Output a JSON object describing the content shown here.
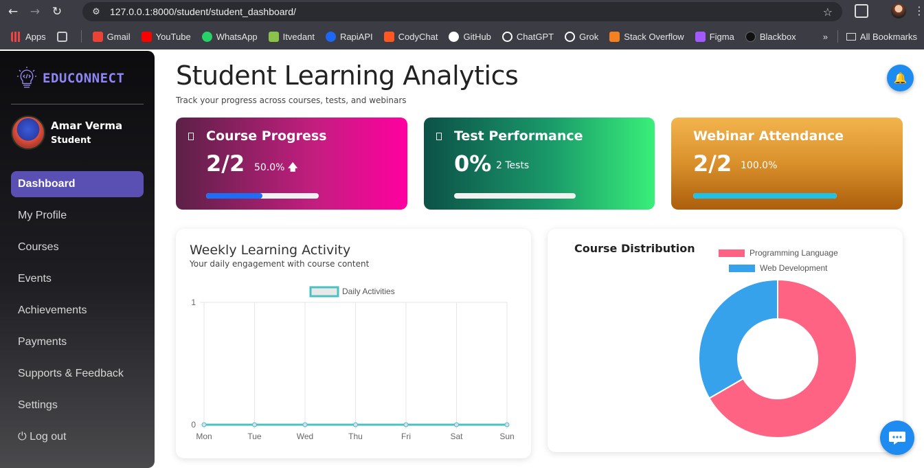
{
  "browser": {
    "url": "127.0.0.1:8000/student/student_dashboard/",
    "bookmarks": [
      {
        "label": "Apps",
        "color": "#e44"
      },
      {
        "label": "",
        "color": "transparent"
      },
      {
        "label": "Gmail",
        "color": "#ea4335"
      },
      {
        "label": "YouTube",
        "color": "#ff0000"
      },
      {
        "label": "WhatsApp",
        "color": "#25d366"
      },
      {
        "label": "Itvedant",
        "color": "#8bc34a"
      },
      {
        "label": "RapiAPI",
        "color": "#1e66f5"
      },
      {
        "label": "CodyChat",
        "color": "#ff5722"
      },
      {
        "label": "GitHub",
        "color": "#ffffff"
      },
      {
        "label": "ChatGPT",
        "color": "#ffffff"
      },
      {
        "label": "Grok",
        "color": "#ffffff"
      },
      {
        "label": "Stack Overflow",
        "color": "#f48024"
      },
      {
        "label": "Figma",
        "color": "#a259ff"
      },
      {
        "label": "Blackbox",
        "color": "#222222"
      }
    ],
    "all_bookmarks": "All Bookmarks"
  },
  "sidebar": {
    "brand": "EDUCONNECT",
    "user_name": "Amar Verma",
    "user_role": "Student",
    "items": [
      {
        "label": "Dashboard",
        "active": true
      },
      {
        "label": "My Profile"
      },
      {
        "label": "Courses"
      },
      {
        "label": "Events"
      },
      {
        "label": "Achievements"
      },
      {
        "label": "Payments"
      },
      {
        "label": "Supports & Feedback"
      },
      {
        "label": "Settings"
      },
      {
        "label": "⏻ Log out"
      }
    ]
  },
  "header": {
    "title": "Student Learning Analytics",
    "subtitle": "Track your progress across courses, tests, and webinars"
  },
  "cards": [
    {
      "title": "Course Progress",
      "big": "2/2",
      "small": "50.0%",
      "arrow": "🡅",
      "progress": 0.5,
      "fill_color": "#1e6ef5",
      "track_width": 164
    },
    {
      "title": "Test Performance",
      "big": "0%",
      "small": "2 Tests",
      "progress": 0.0,
      "fill_color": "#1e6ef5",
      "track_width": 177
    },
    {
      "title": "Webinar Attendance",
      "big": "2/2",
      "small": "100.0%",
      "progress": 1.0,
      "fill_color": "#1fc1e6",
      "track_width": 209
    }
  ],
  "weekly": {
    "title": "Weekly Learning Activity",
    "subtitle": "Your daily engagement with course content"
  },
  "distribution": {
    "title": "Course Distribution"
  },
  "chart_data": [
    {
      "type": "line",
      "categories": [
        "Mon",
        "Tue",
        "Wed",
        "Thu",
        "Fri",
        "Sat",
        "Sun"
      ],
      "series": [
        {
          "name": "Daily Activities",
          "values": [
            0,
            0,
            0,
            0,
            0,
            0,
            0
          ],
          "color": "#4bc0c0"
        }
      ],
      "ylim": [
        0,
        1
      ],
      "yticks": [
        "1",
        "0"
      ],
      "grid": true,
      "legend": "top-center"
    },
    {
      "type": "pie",
      "categories": [
        "Programming Language",
        "Web Development"
      ],
      "values": [
        2,
        1
      ],
      "colors": [
        "#ff6384",
        "#36a2eb"
      ],
      "legend": "top-center"
    }
  ]
}
